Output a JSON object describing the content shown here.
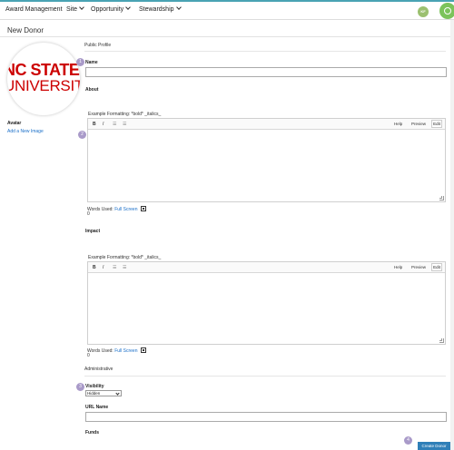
{
  "header": {
    "brand": "Award Management",
    "menus": [
      {
        "label": "Site"
      },
      {
        "label": "Opportunity"
      },
      {
        "label": "Stewardship"
      }
    ],
    "user_initials": "KF"
  },
  "page": {
    "title": "New Donor"
  },
  "sidebar": {
    "logo": {
      "line1": "NC STATE",
      "line2": "UNIVERSITY"
    },
    "avatar_label": "Avatar",
    "add_image_link": "Add a New Image"
  },
  "form": {
    "public_profile_heading": "Public Profile",
    "name_label": "Name",
    "name_value": "",
    "about": {
      "label": "About",
      "hint": "Example Formatting: *bold* _italics_",
      "toolbar": {
        "bold": "B",
        "italic": "I",
        "bullet": "☰",
        "numbered": "☰",
        "help": "Help",
        "preview": "Preview",
        "edit": "Edit"
      },
      "words_used": "Words Used:",
      "fullscreen": "Full Screen",
      "count": "0"
    },
    "impact": {
      "label": "Impact",
      "hint": "Example Formatting: *bold* _italics_",
      "toolbar": {
        "bold": "B",
        "italic": "I",
        "bullet": "☰",
        "numbered": "☰",
        "help": "Help",
        "preview": "Preview",
        "edit": "Edit"
      },
      "words_used": "Words Used:",
      "fullscreen": "Full Screen",
      "count": "0"
    },
    "administrative_heading": "Administrative",
    "visibility_label": "Visibility",
    "visibility_value": "Hidden",
    "url_name_label": "URL Name",
    "url_name_value": "",
    "funds_label": "Funds",
    "submit_label": "Create Donor"
  },
  "markers": [
    "1",
    "2",
    "3",
    "4"
  ]
}
